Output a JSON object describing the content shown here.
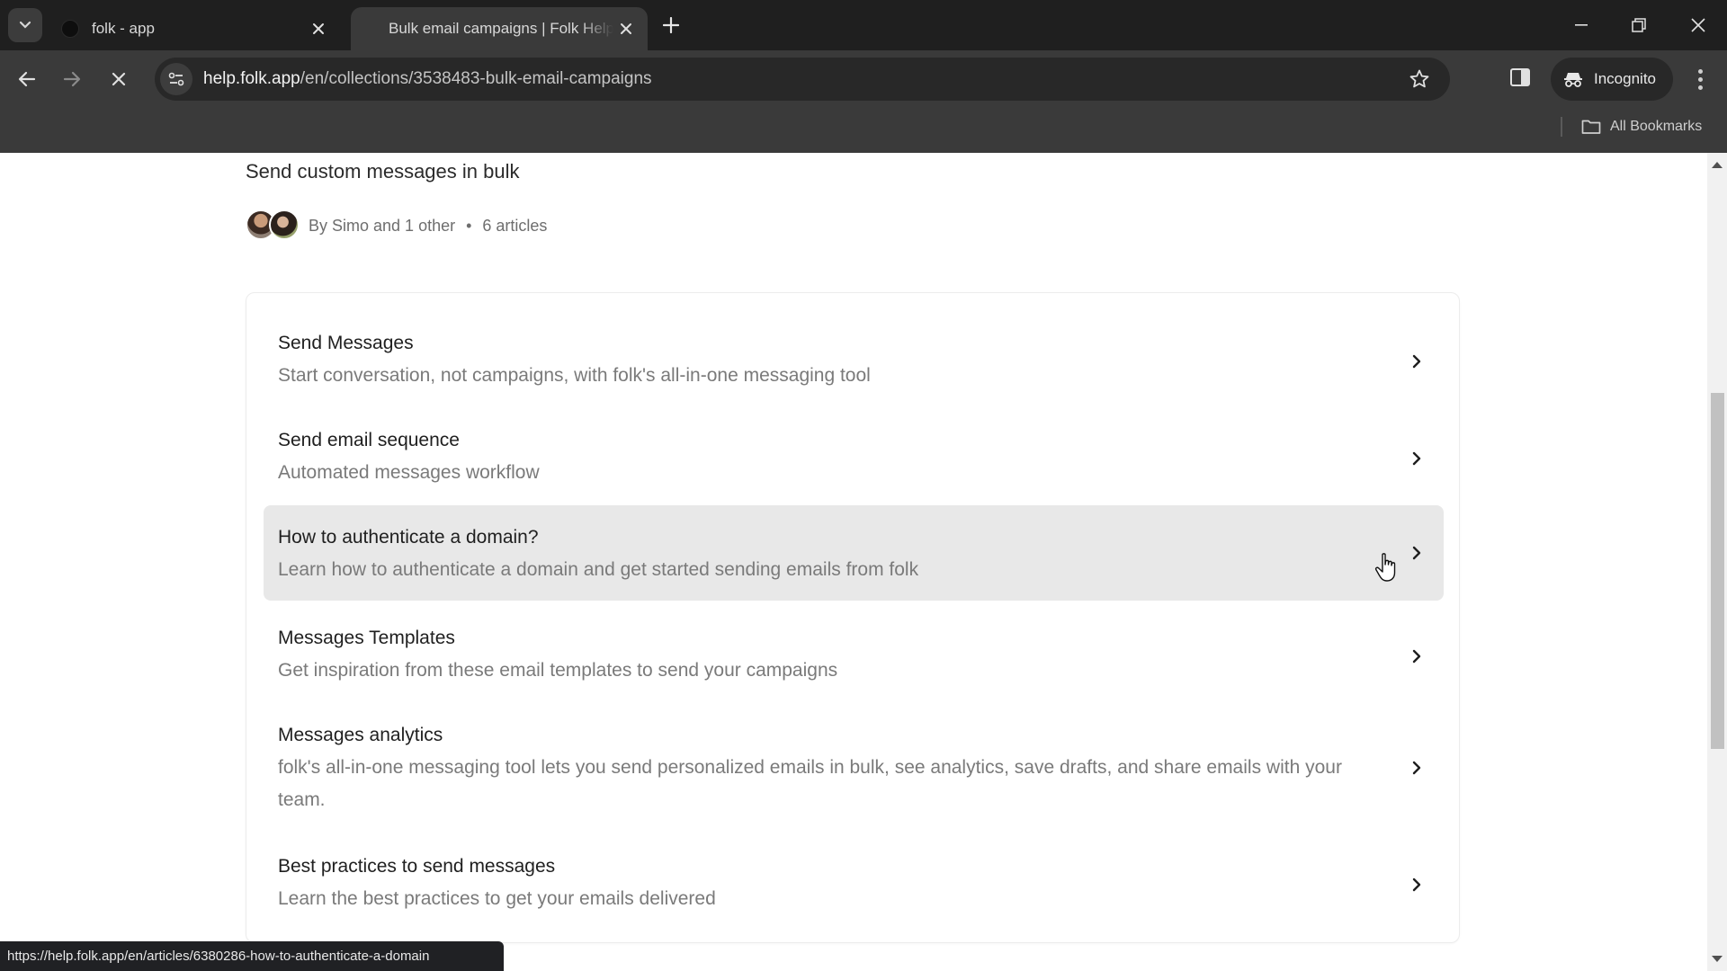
{
  "browser": {
    "tabs": [
      {
        "title": "folk - app",
        "active": false
      },
      {
        "title": "Bulk email campaigns | Folk Help Center",
        "active": true,
        "loading": true
      }
    ],
    "new_tab_icon": "plus-icon",
    "address": {
      "host": "help.folk.app",
      "path": "/en/collections/3538483-bulk-email-campaigns"
    },
    "profile_label": "Incognito",
    "bookmarks_label": "All Bookmarks",
    "status_url": "https://help.folk.app/en/articles/6380286-how-to-authenticate-a-domain"
  },
  "collection": {
    "description": "Send custom messages in bulk",
    "authors_text": "By Simo and 1 other",
    "separator": "•",
    "article_count": "6 articles"
  },
  "articles": [
    {
      "title": "Send Messages",
      "description": "Start conversation, not campaigns, with folk's all-in-one messaging tool",
      "hovered": false
    },
    {
      "title": "Send email sequence",
      "description": "Automated messages workflow",
      "hovered": false
    },
    {
      "title": "How to authenticate a domain?",
      "description": "Learn how to authenticate a domain and get started sending emails from folk",
      "hovered": true
    },
    {
      "title": "Messages Templates",
      "description": "Get inspiration from these email templates to send your campaigns",
      "hovered": false
    },
    {
      "title": "Messages analytics",
      "description": "folk's all-in-one messaging tool lets you send personalized emails in bulk, see analytics, save drafts, and share emails with your team.",
      "hovered": false
    },
    {
      "title": "Best practices to send messages",
      "description": "Learn the best practices to get your emails delivered",
      "hovered": false
    }
  ],
  "colors": {
    "hover_row": "#e8e8e8",
    "title_text": "#1f1f1f",
    "desc_text": "#7a7a7a"
  }
}
